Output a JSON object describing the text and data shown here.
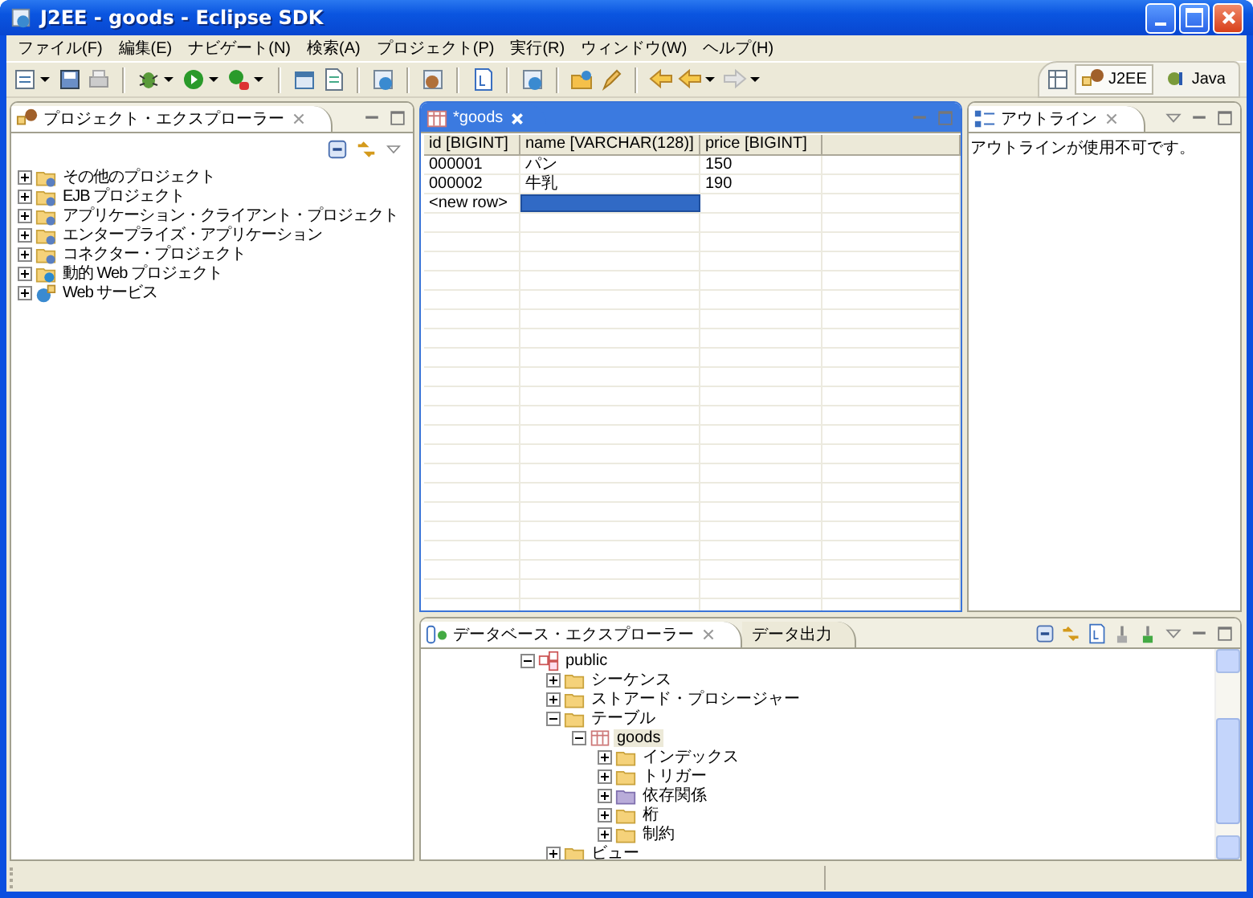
{
  "window": {
    "title": "J2EE - goods - Eclipse SDK"
  },
  "menu": [
    "ファイル(F)",
    "編集(E)",
    "ナビゲート(N)",
    "検索(A)",
    "プロジェクト(P)",
    "実行(R)",
    "ウィンドウ(W)",
    "ヘルプ(H)"
  ],
  "perspectives": [
    {
      "label": "J2EE",
      "selected": true
    },
    {
      "label": "Java",
      "selected": false
    }
  ],
  "project_explorer": {
    "title": "プロジェクト・エクスプローラー",
    "items": [
      {
        "label": "その他のプロジェクト",
        "expanded": false
      },
      {
        "label": "EJB プロジェクト",
        "expanded": false
      },
      {
        "label": "アプリケーション・クライアント・プロジェクト",
        "expanded": false
      },
      {
        "label": "エンタープライズ・アプリケーション",
        "expanded": false
      },
      {
        "label": "コネクター・プロジェクト",
        "expanded": false
      },
      {
        "label": "動的 Web プロジェクト",
        "expanded": false
      },
      {
        "label": "Web サービス",
        "expanded": false
      }
    ]
  },
  "editor": {
    "tab": "*goods",
    "columns": [
      "id [BIGINT]",
      "name [VARCHAR(128)]",
      "price [BIGINT]"
    ],
    "rows": [
      {
        "cells": [
          "000001",
          "パン",
          "150"
        ]
      },
      {
        "cells": [
          "000002",
          "牛乳",
          "190"
        ]
      }
    ],
    "new_row": {
      "label": "<new row>",
      "editing": true
    }
  },
  "outline": {
    "title": "アウトライン",
    "message": "アウトラインが使用不可です。"
  },
  "bottom": {
    "tabs": [
      {
        "label": "データベース・エクスプローラー",
        "selected": true
      },
      {
        "label": "データ出力",
        "selected": false
      }
    ],
    "tree": [
      {
        "label": "public",
        "kind": "schema",
        "expanded": true,
        "selected": false,
        "children": [
          {
            "label": "シーケンス",
            "kind": "folder",
            "expanded": false,
            "selected": false
          },
          {
            "label": "ストアード・プロシージャー",
            "kind": "folder",
            "expanded": false,
            "selected": false
          },
          {
            "label": "テーブル",
            "kind": "folder",
            "expanded": true,
            "selected": false,
            "children": [
              {
                "label": "goods",
                "kind": "table",
                "expanded": true,
                "selected": true,
                "children": [
                  {
                    "label": "インデックス",
                    "kind": "folder",
                    "expanded": false,
                    "selected": false
                  },
                  {
                    "label": "トリガー",
                    "kind": "folder",
                    "expanded": false,
                    "selected": false
                  },
                  {
                    "label": "依存関係",
                    "kind": "special-folder",
                    "expanded": false,
                    "selected": false
                  },
                  {
                    "label": "桁",
                    "kind": "folder",
                    "expanded": false,
                    "selected": false
                  },
                  {
                    "label": "制約",
                    "kind": "folder",
                    "expanded": false,
                    "selected": false
                  }
                ]
              }
            ]
          },
          {
            "label": "ビュー",
            "kind": "folder",
            "expanded": false,
            "selected": false
          }
        ]
      }
    ]
  }
}
